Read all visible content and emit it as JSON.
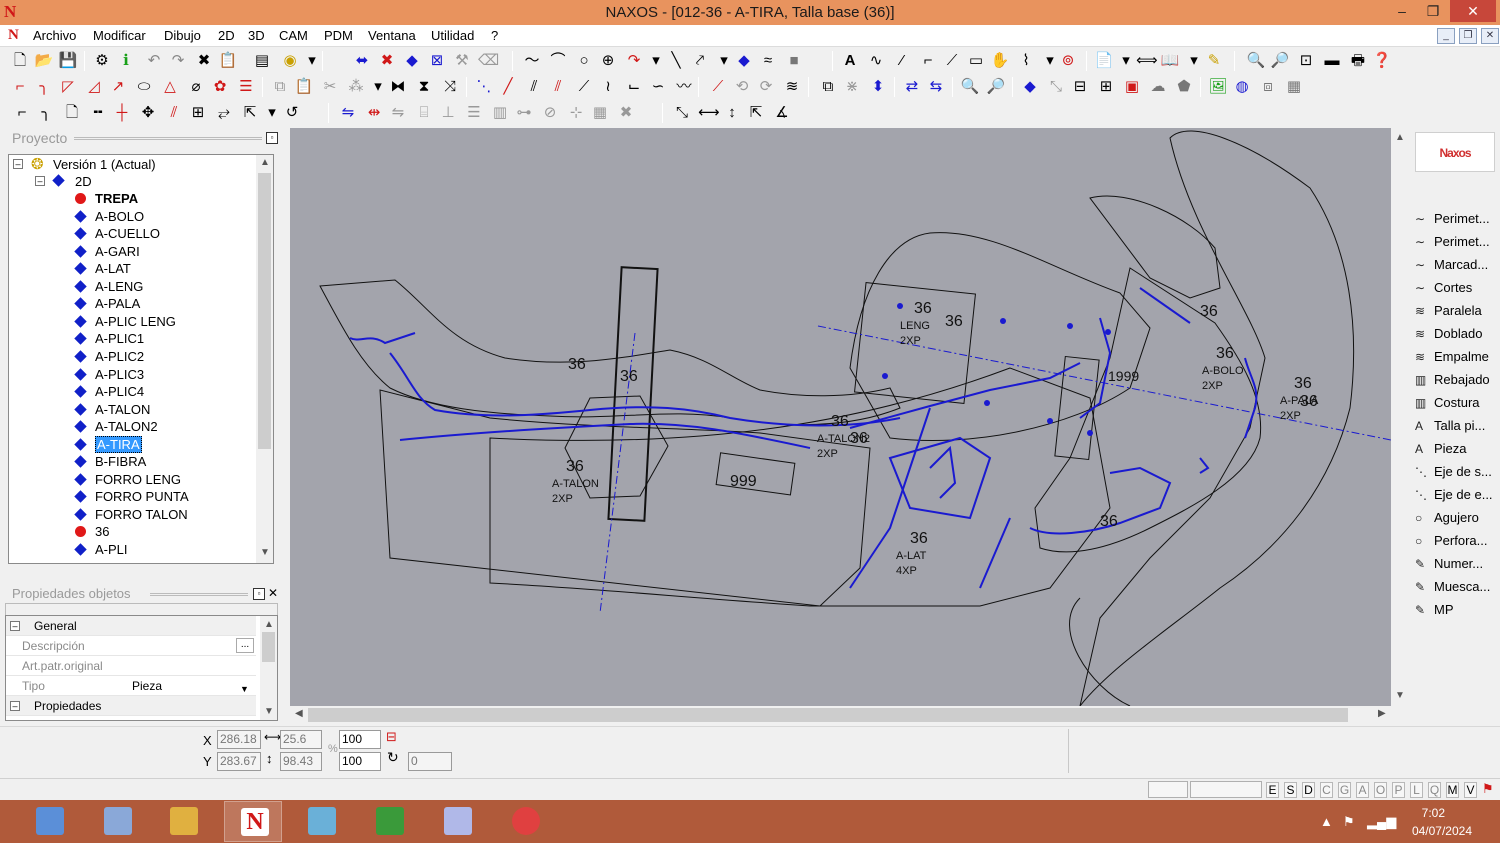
{
  "window": {
    "title": "NAXOS - [012-36 - A-TIRA, Talla base (36)]",
    "app_icon": "N",
    "minimize": "–",
    "maximize": "❐",
    "close": "✕"
  },
  "menu": {
    "items": [
      "Archivo",
      "Modificar",
      "Dibujo",
      "2D",
      "3D",
      "CAM",
      "PDM",
      "Ventana",
      "Utilidad",
      "?"
    ]
  },
  "project_panel": {
    "title": "Proyecto",
    "tree": {
      "root": "Versión 1 (Actual)",
      "folder": "2D",
      "items": [
        {
          "label": "TREPA",
          "type": "dot",
          "bold": true
        },
        {
          "label": "A-BOLO",
          "type": "diamond"
        },
        {
          "label": "A-CUELLO",
          "type": "diamond"
        },
        {
          "label": "A-GARI",
          "type": "diamond"
        },
        {
          "label": "A-LAT",
          "type": "diamond"
        },
        {
          "label": "A-LENG",
          "type": "diamond"
        },
        {
          "label": "A-PALA",
          "type": "diamond"
        },
        {
          "label": "A-PLIC LENG",
          "type": "diamond"
        },
        {
          "label": "A-PLIC1",
          "type": "diamond"
        },
        {
          "label": "A-PLIC2",
          "type": "diamond"
        },
        {
          "label": "A-PLIC3",
          "type": "diamond"
        },
        {
          "label": "A-PLIC4",
          "type": "diamond"
        },
        {
          "label": "A-TALON",
          "type": "diamond"
        },
        {
          "label": "A-TALON2",
          "type": "diamond"
        },
        {
          "label": "A-TIRA",
          "type": "diamond",
          "selected": true
        },
        {
          "label": "B-FIBRA",
          "type": "diamond"
        },
        {
          "label": "FORRO LENG",
          "type": "diamond"
        },
        {
          "label": "FORRO PUNTA",
          "type": "diamond"
        },
        {
          "label": "FORRO TALON",
          "type": "diamond"
        },
        {
          "label": "36",
          "type": "dot"
        },
        {
          "label": "A-PLI",
          "type": "diamond"
        }
      ]
    }
  },
  "properties_panel": {
    "title": "Propiedades objetos",
    "rows": [
      {
        "name": "General",
        "category": true
      },
      {
        "name": "Descripción",
        "value": "",
        "button": "..."
      },
      {
        "name": "Art.patr.original",
        "value": ""
      },
      {
        "name": "Tipo",
        "value": "Pieza",
        "dropdown": true
      },
      {
        "name": "Propiedades",
        "category": true
      }
    ]
  },
  "canvas": {
    "pieces": [
      {
        "size": "36",
        "name": "A-TALON",
        "count": "2XP"
      },
      {
        "size": "36",
        "name": "A-TALON2",
        "count": "2XP"
      },
      {
        "size": "36",
        "name": "A-LAT",
        "count": "4XP"
      },
      {
        "size": "36",
        "name": "A-BOLO",
        "count": "2XP"
      },
      {
        "size": "36",
        "name": "A-PALA",
        "count": "2XP"
      },
      {
        "size": "36",
        "name": "LENG",
        "count": "2XP"
      }
    ],
    "extra_labels": [
      "36",
      "36",
      "36",
      "36",
      "36",
      "36",
      "999",
      "1999",
      "36"
    ]
  },
  "right_palette": {
    "logo": "Naxos",
    "items": [
      {
        "label": "Perimet...",
        "icon": "curve-icon"
      },
      {
        "label": "Perimet...",
        "icon": "curve-icon"
      },
      {
        "label": "Marcad...",
        "icon": "curve-icon"
      },
      {
        "label": "Cortes",
        "icon": "curve-icon"
      },
      {
        "label": "Paralela",
        "icon": "parallel-icon"
      },
      {
        "label": "Doblado",
        "icon": "parallel-icon"
      },
      {
        "label": "Empalme",
        "icon": "parallel-icon"
      },
      {
        "label": "Rebajado",
        "icon": "book-icon"
      },
      {
        "label": "Costura",
        "icon": "book-icon"
      },
      {
        "label": "Talla pi...",
        "icon": "text-icon"
      },
      {
        "label": "Pieza",
        "icon": "text-icon"
      },
      {
        "label": "Eje de s...",
        "icon": "axis-icon"
      },
      {
        "label": "Eje de e...",
        "icon": "axis-icon"
      },
      {
        "label": "Agujero",
        "icon": "circle-icon"
      },
      {
        "label": "Perfora...",
        "icon": "circle-icon"
      },
      {
        "label": "Numer...",
        "icon": "pen-icon"
      },
      {
        "label": "Muesca...",
        "icon": "pen-icon"
      },
      {
        "label": "MP",
        "icon": "pen-icon"
      }
    ]
  },
  "coords": {
    "x_label": "X",
    "y_label": "Y",
    "x_value": "286.18",
    "y_value": "283.67",
    "width_value": "25.6",
    "height_value": "98.43",
    "scale_x": "100",
    "scale_y": "100",
    "rotation": "0",
    "percent": "%"
  },
  "status": {
    "modes": [
      "E",
      "S",
      "D",
      "C",
      "G",
      "A",
      "O",
      "P",
      "L",
      "Q",
      "M",
      "V"
    ],
    "active_modes": [
      "E",
      "S",
      "D",
      "M",
      "V"
    ]
  },
  "taskbar": {
    "time": "7:02",
    "date": "04/07/2024",
    "apps": [
      "calculator-icon",
      "explorer-shell-icon",
      "folder-icon",
      "naxos-icon",
      "notebook-icon",
      "leaf-app-icon",
      "document-app-icon",
      "chrome-icon"
    ]
  },
  "colors": {
    "titlebar": "#e8935e",
    "canvas_bg": "#a3a4ac",
    "accent_blue": "#1a1ad0",
    "taskbar": "#b05a3a"
  }
}
